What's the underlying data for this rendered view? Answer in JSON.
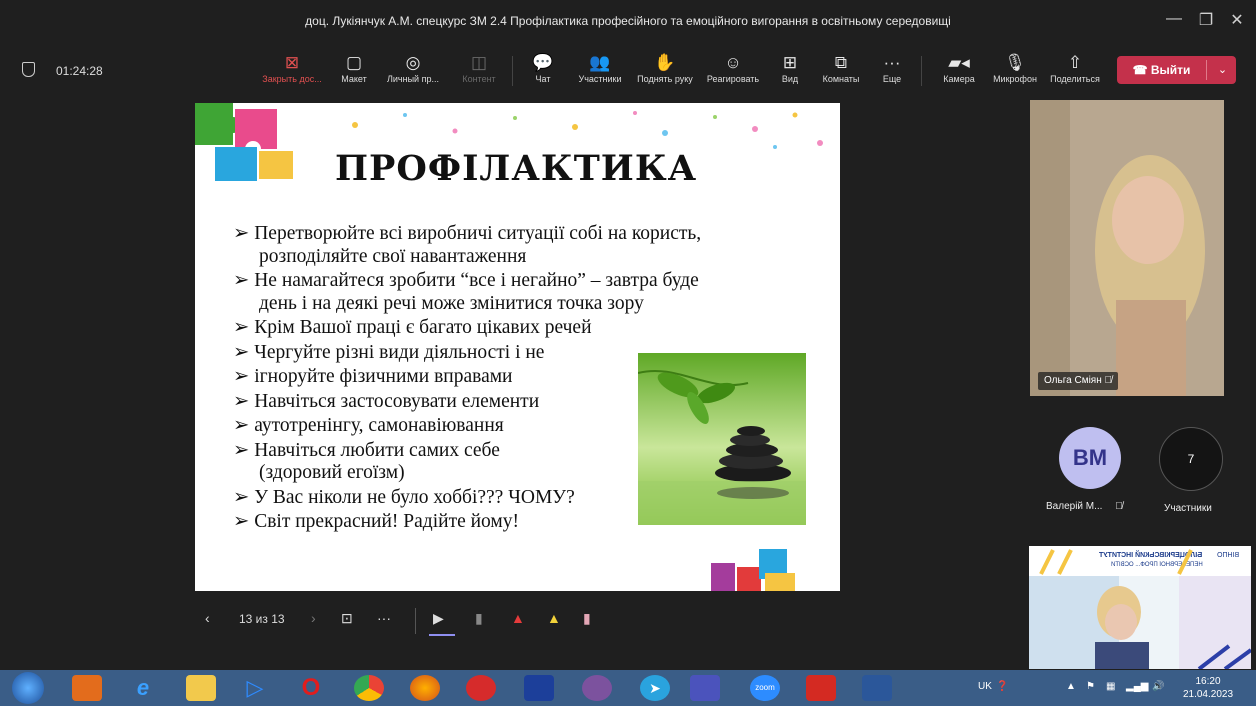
{
  "window": {
    "title": "доц. Лукіянчук А.М. спецкурс ЗМ 2.4 Профілактика професійного та емоційного вигорання в освітньому середовищі"
  },
  "meeting": {
    "timer": "01:24:28"
  },
  "toolbar": {
    "close_share": "Закрыть дос...",
    "layout": "Макет",
    "personal": "Личный пр...",
    "content": "Контент",
    "chat": "Чат",
    "participants": "Участники",
    "raise_hand": "Поднять руку",
    "react": "Реагировать",
    "view": "Вид",
    "rooms": "Комнаты",
    "more": "Еще",
    "camera": "Камера",
    "mic": "Микрофон",
    "share": "Поделиться",
    "leave": "Выйти"
  },
  "slide": {
    "title": "ПРОФІЛАКТИКА",
    "bullets": [
      "➢ Перетворюйте всі виробничі  ситуації собі на користь,",
      "розподіляйте свої навантаження",
      "➢ Не намагайтеся зробити “все і негайно” – завтра буде",
      "день і на деякі речі може змінитися точка зору",
      "➢ Крім Вашої праці є багато цікавих речей",
      "➢ Чергуйте різні види діяльності і не",
      "➢ ігноруйте фізичними вправами",
      "➢ Навчіться застосовувати елементи",
      "➢  аутотренінгу, самонавіювання",
      "➢ Навчіться любити самих себе",
      "(здоровий егоїзм)",
      "➢ У Вас ніколи не було хоббі??? ЧОМУ?",
      "➢ Світ прекрасний! Радійте йому!"
    ]
  },
  "slide_nav": {
    "counter": "13 из 13"
  },
  "participants_panel": {
    "video_name": "Ольга Сміян",
    "avatar_initials": "ВМ",
    "avatar_name": "Валерій М...",
    "count": "7",
    "count_label": "Участники"
  },
  "shared_video": {
    "institute_name": "БІЛОЦЕРКІВСЬКИЙ ІНСТИТУТ",
    "subtitle": "НЕПЕРЕРВНОЇ ПРОФ... ОСВІТИ",
    "brand": "ВІНПО"
  },
  "taskbar": {
    "lang": "UK",
    "time": "16:20",
    "date": "21.04.2023",
    "zoom_label": "zoom"
  },
  "colors": {
    "leave_red": "#c4314b",
    "taskbar_blue": "#3a5d87",
    "avatar_bg": "#bfbff0"
  }
}
